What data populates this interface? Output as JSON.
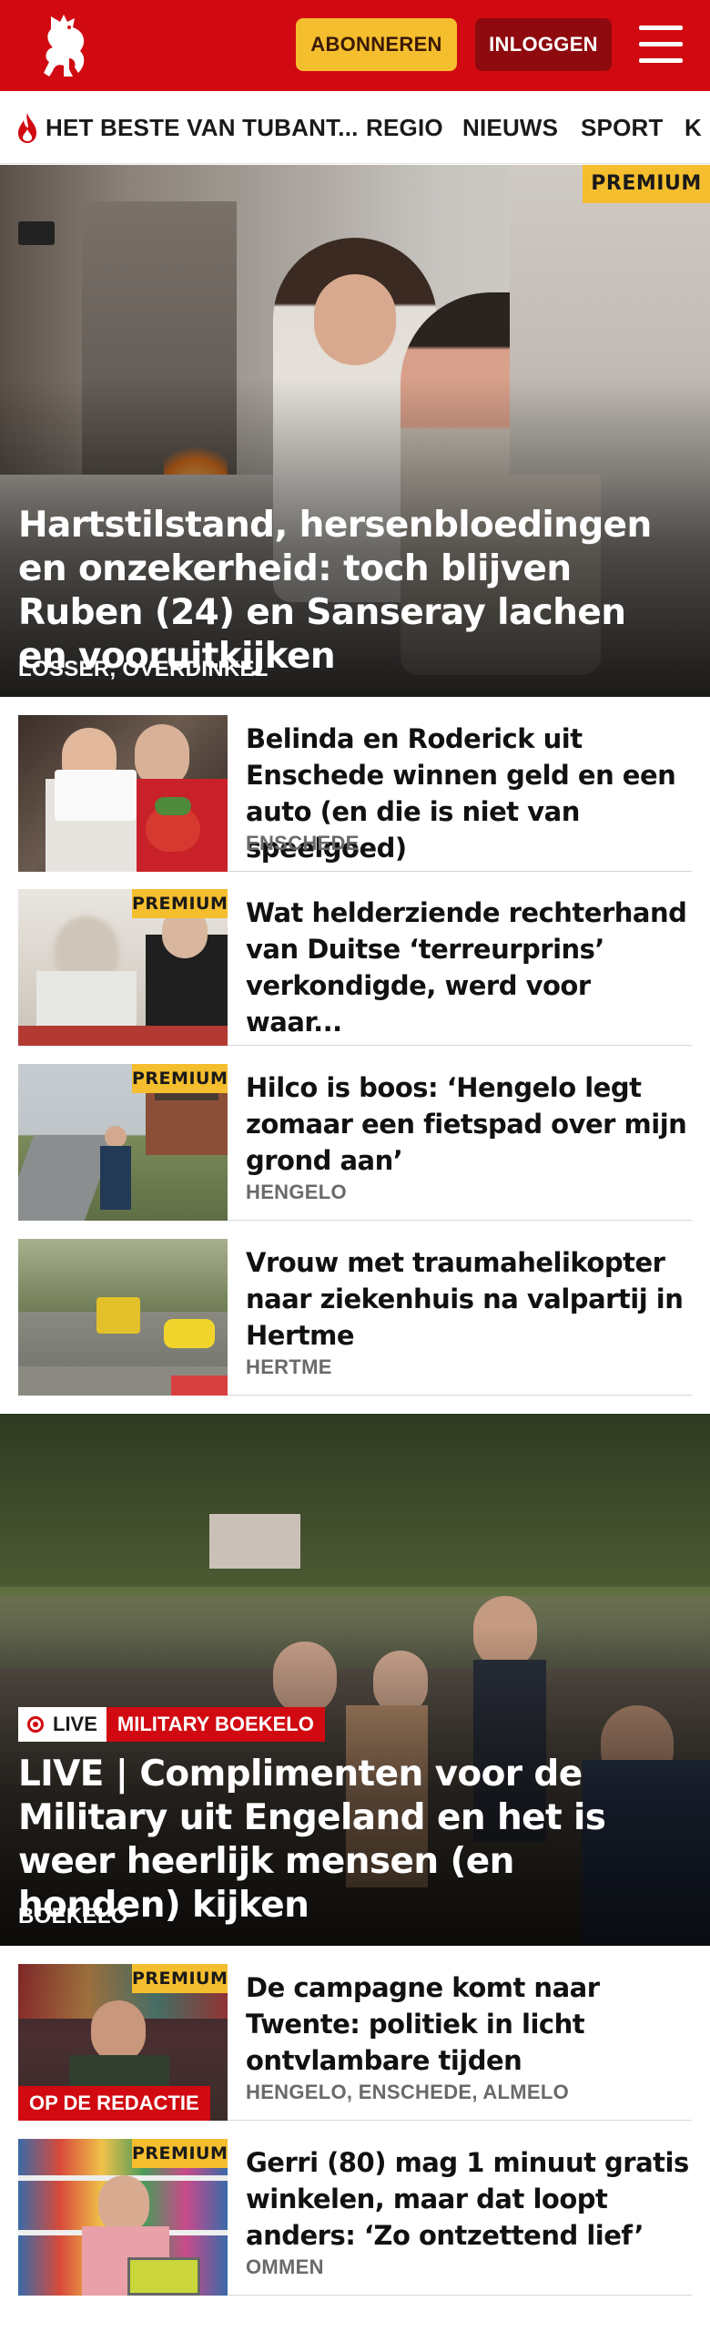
{
  "header": {
    "logo_icon": "tubantia-horse-icon",
    "subscribe_label": "ABONNEREN",
    "login_label": "INLOGGEN",
    "menu_icon": "hamburger-menu-icon",
    "brand_color": "#d10a11",
    "accent_color": "#f5be2e"
  },
  "nav": {
    "items": [
      {
        "label": "HET BESTE VAN TUBANT..."
      },
      {
        "label": "REGIO"
      },
      {
        "label": "NIEUWS"
      },
      {
        "label": "SPORT"
      },
      {
        "label": "K"
      }
    ],
    "flame_icon": "flame-icon"
  },
  "hero": {
    "badge": "PREMIUM",
    "title": "Hartstilstand, hersenbloedingen en onzekerheid: toch blijven Ruben (24) en Sanseray lachen en vooruitkijken",
    "location": "LOSSER, OVERDINKEL"
  },
  "articles": [
    {
      "title": "Belinda en Roderick uit Enschede winnen geld en een auto (en die is niet van speelgoed)",
      "location": "ENSCHEDE",
      "badge": ""
    },
    {
      "title": "Wat helderziende rechterhand van Duitse ‘terreurprins’ verkondigde, werd voor waar...",
      "location": "",
      "badge": "PREMIUM"
    },
    {
      "title": "Hilco is boos: ‘Hengelo legt zomaar een fietspad over mijn grond aan’",
      "location": "HENGELO",
      "badge": "PREMIUM"
    },
    {
      "title": "Vrouw met traumahelikopter naar ziekenhuis na valpartij in Hertme",
      "location": "HERTME",
      "badge": ""
    }
  ],
  "live_hero": {
    "live_label": "LIVE",
    "category": "MILITARY BOEKELO",
    "title": "LIVE | Complimenten voor de Military uit Engeland en het is weer heerlijk mensen (en honden) kijken",
    "location": "BOEKELO"
  },
  "articles2": [
    {
      "title": "De campagne komt naar Twente: politiek in licht ontvlambare tijden",
      "location": "HENGELO, ENSCHEDE, ALMELO",
      "badge": "PREMIUM",
      "overlay": "OP DE REDACTIE"
    },
    {
      "title": "Gerri (80) mag 1 minuut gratis winkelen, maar dat loopt anders: ‘Zo ontzettend lief’",
      "location": "OMMEN",
      "badge": "PREMIUM"
    }
  ]
}
